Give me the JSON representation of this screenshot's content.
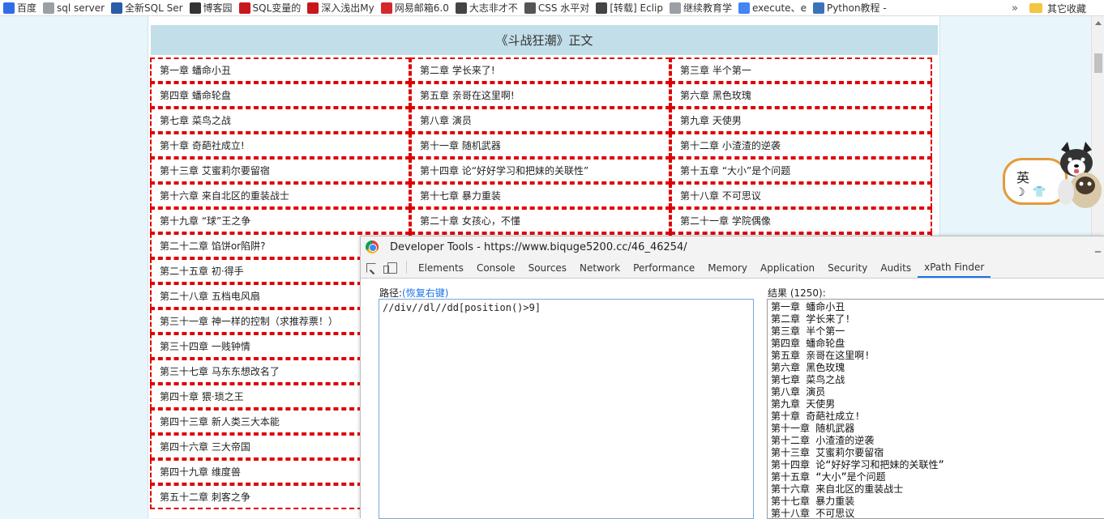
{
  "bookmarks": [
    {
      "label": "百度",
      "icon": "baidu-icon",
      "color": "#2f6ee6"
    },
    {
      "label": "sql server",
      "icon": "page-icon",
      "color": "#9aa0a6"
    },
    {
      "label": "全新SQL Ser",
      "icon": "sql-icon",
      "color": "#2a5caa"
    },
    {
      "label": "博客园",
      "icon": "cnblogs-icon",
      "color": "#333333"
    },
    {
      "label": "SQL变量的",
      "icon": "csdn-icon",
      "color": "#c8161d"
    },
    {
      "label": "深入浅出My",
      "icon": "csdn-icon",
      "color": "#c8161d"
    },
    {
      "label": "网易邮箱6.0",
      "icon": "mail-icon",
      "color": "#d22a2a"
    },
    {
      "label": "大志非才不",
      "icon": "blog-icon",
      "color": "#444444"
    },
    {
      "label": "CSS 水平对",
      "icon": "css-icon",
      "color": "#555555"
    },
    {
      "label": "[转载] Eclip",
      "icon": "blog-icon",
      "color": "#444444"
    },
    {
      "label": "继续教育学",
      "icon": "page-icon",
      "color": "#9aa0a6"
    },
    {
      "label": "execute、e",
      "icon": "google-icon",
      "color": "#4285f4"
    },
    {
      "label": "Python教程 -",
      "icon": "python-icon",
      "color": "#3b73b9"
    }
  ],
  "bookmarks_more": "»",
  "other_bookmarks": "其它收藏",
  "book_title": "《斗战狂潮》正文",
  "chapters": [
    [
      "第一章 蟠命小丑",
      "第二章 学长来了!",
      "第三章 半个第一"
    ],
    [
      "第四章 蟠命轮盘",
      "第五章 亲哥在这里啊!",
      "第六章 黑色玫瑰"
    ],
    [
      "第七章 菜鸟之战",
      "第八章 演员",
      "第九章 天使男"
    ],
    [
      "第十章 奇葩社成立!",
      "第十一章 随机武器",
      "第十二章 小渣渣的逆袭"
    ],
    [
      "第十三章 艾蜜莉尔要留宿",
      "第十四章 论“好好学习和把妹的关联性”",
      "第十五章 “大小”是个问题"
    ],
    [
      "第十六章 来自北区的重装战士",
      "第十七章 暴力重装",
      "第十八章 不可思议"
    ],
    [
      "第十九章 “球”王之争",
      "第二十章 女孩心，不懂",
      "第二十一章 学院偶像"
    ],
    [
      "第二十二章 馅饼or陷阱?",
      "",
      ""
    ],
    [
      "第二十五章 初·得手",
      "",
      ""
    ],
    [
      "第二十八章 五档电风扇",
      "",
      ""
    ],
    [
      "第三十一章 神一样的控制（求推荐票！）",
      "",
      ""
    ],
    [
      "第三十四章 一贱钟情",
      "",
      ""
    ],
    [
      "第三十七章 马东东想改名了",
      "",
      ""
    ],
    [
      "第四十章 猥·琐之王",
      "",
      ""
    ],
    [
      "第四十三章 新人类三大本能",
      "",
      ""
    ],
    [
      "第四十六章 三大帝国",
      "",
      ""
    ],
    [
      "第四十九章 维度兽",
      "",
      ""
    ],
    [
      "第五十二章 刺客之争",
      "",
      ""
    ]
  ],
  "mascot": {
    "label": "英",
    "moon": "☽",
    "shirt": "👕"
  },
  "devtools": {
    "title": "Developer Tools - https://www.biquge5200.cc/46_46254/",
    "minimize": "_",
    "tabs": [
      "Elements",
      "Console",
      "Sources",
      "Network",
      "Performance",
      "Memory",
      "Application",
      "Security",
      "Audits",
      "xPath Finder"
    ],
    "active_tab": "xPath Finder",
    "path_label": "路径:",
    "restore_shortcut": "(恢复右键)",
    "xpath": "//div//dl//dd[position()>9]",
    "result_label": "结果 (1250):",
    "results": [
      "第一章 蟠命小丑",
      "第二章 学长来了!",
      "第三章 半个第一",
      "第四章 蟠命轮盘",
      "第五章 亲哥在这里啊!",
      "第六章 黑色玫瑰",
      "第七章 菜鸟之战",
      "第八章 演员",
      "第九章 天使男",
      "第十章 奇葩社成立!",
      "第十一章 随机武器",
      "第十二章 小渣渣的逆袭",
      "第十三章 艾蜜莉尔要留宿",
      "第十四章 论“好好学习和把妹的关联性”",
      "第十五章 “大小”是个问题",
      "第十六章 来自北区的重装战士",
      "第十七章 暴力重装",
      "第十八章 不可思议"
    ]
  }
}
